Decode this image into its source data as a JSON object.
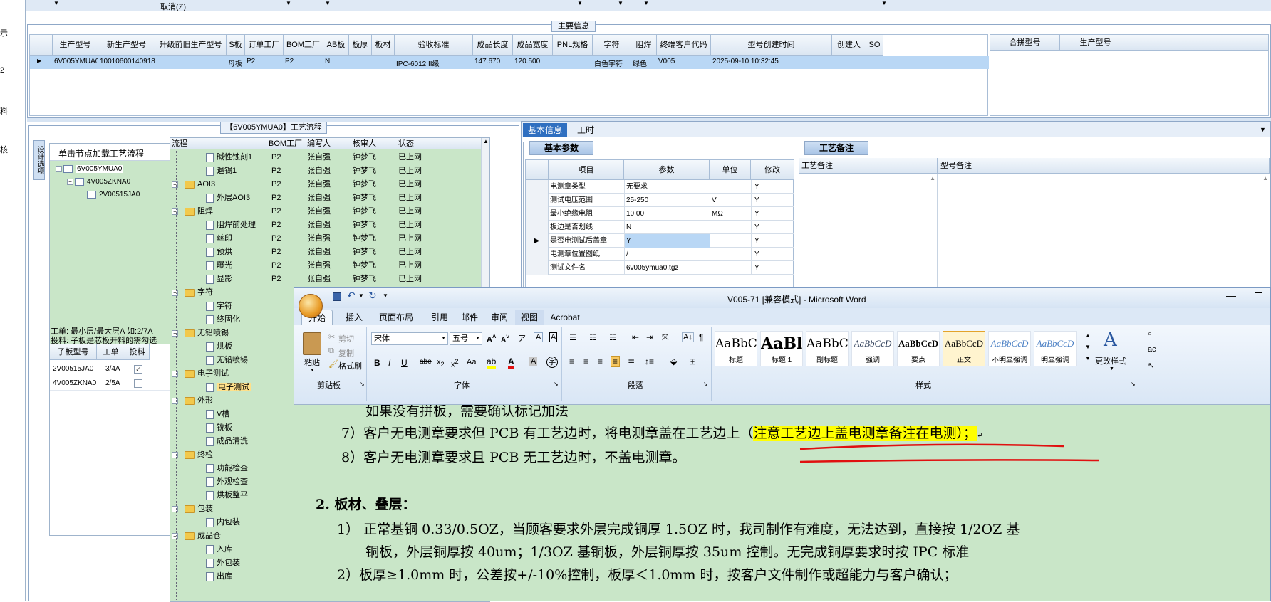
{
  "left_edge": {
    "items": [
      "示",
      "2",
      "料",
      "核"
    ]
  },
  "topbar": {
    "cancel_label": "取消(Z)"
  },
  "main_info": {
    "title": "主要信息",
    "columns": [
      "生产型号",
      "新生产型号",
      "升级前旧生产型号",
      "S板",
      "订单工厂",
      "BOM工厂",
      "AB板",
      "板厚",
      "板材",
      "验收标准",
      "成品长度",
      "成品宽度",
      "PNL规格",
      "字符",
      "阻焊",
      "终端客户代码",
      "型号创建时间",
      "创建人",
      "SO"
    ],
    "row": [
      "6V005YMUA0",
      "10010600140918",
      "",
      "母板",
      "P2",
      "P2",
      "N",
      "",
      "",
      "IPC-6012 II级",
      "147.670",
      "120.500",
      "",
      "白色字符",
      "绿色",
      "V005",
      "2025-09-10 10:32:45",
      "",
      ""
    ],
    "right_columns": [
      "合拼型号",
      "生产型号"
    ]
  },
  "process": {
    "title": "【6V005YMUA0】工艺流程",
    "side_tab": "设计选项",
    "tree_header": "单击节点加载工艺流程",
    "tree": [
      "6V005YMUA0",
      "4V005ZKNA0",
      "2V00515JA0"
    ],
    "note_line1": "工单: 最小层/最大层A 如:2/7A",
    "note_line2": "投料: 子板是芯板开料的需勾选",
    "sub_columns": [
      "子板型号",
      "工单",
      "投料"
    ],
    "sub_rows": [
      {
        "model": "2V00515JA0",
        "order": "3/4A",
        "checked": true
      },
      {
        "model": "4V005ZKNA0",
        "order": "2/5A",
        "checked": false
      }
    ],
    "flow_columns": [
      "流程",
      "BOM工厂",
      "编写人",
      "核审人",
      "状态"
    ],
    "flow_rows": [
      {
        "name": "碱性蚀刻1",
        "type": "doc",
        "indent": 2,
        "bom": "P2",
        "writer": "张自强",
        "reviewer": "钟梦飞",
        "status": "已上网"
      },
      {
        "name": "退锡1",
        "type": "doc",
        "indent": 2,
        "bom": "P2",
        "writer": "张自强",
        "reviewer": "钟梦飞",
        "status": "已上网"
      },
      {
        "name": "AOI3",
        "type": "folder",
        "indent": 1,
        "bom": "P2",
        "writer": "张自强",
        "reviewer": "钟梦飞",
        "status": "已上网"
      },
      {
        "name": "外层AOI3",
        "type": "doc",
        "indent": 2,
        "bom": "P2",
        "writer": "张自强",
        "reviewer": "钟梦飞",
        "status": "已上网"
      },
      {
        "name": "阻焊",
        "type": "folder",
        "indent": 1,
        "bom": "P2",
        "writer": "张自强",
        "reviewer": "钟梦飞",
        "status": "已上网"
      },
      {
        "name": "阻焊前处理",
        "type": "doc",
        "indent": 2,
        "bom": "P2",
        "writer": "张自强",
        "reviewer": "钟梦飞",
        "status": "已上网"
      },
      {
        "name": "丝印",
        "type": "doc",
        "indent": 2,
        "bom": "P2",
        "writer": "张自强",
        "reviewer": "钟梦飞",
        "status": "已上网"
      },
      {
        "name": "预烘",
        "type": "doc",
        "indent": 2,
        "bom": "P2",
        "writer": "张自强",
        "reviewer": "钟梦飞",
        "status": "已上网"
      },
      {
        "name": "曝光",
        "type": "doc",
        "indent": 2,
        "bom": "P2",
        "writer": "张自强",
        "reviewer": "钟梦飞",
        "status": "已上网"
      },
      {
        "name": "显影",
        "type": "doc",
        "indent": 2,
        "bom": "P2",
        "writer": "张自强",
        "reviewer": "钟梦飞",
        "status": "已上网"
      },
      {
        "name": "字符",
        "type": "folder",
        "indent": 1,
        "bom": "",
        "writer": "",
        "reviewer": "",
        "status": ""
      },
      {
        "name": "字符",
        "type": "doc",
        "indent": 2,
        "bom": "",
        "writer": "",
        "reviewer": "",
        "status": ""
      },
      {
        "name": "终固化",
        "type": "doc",
        "indent": 2,
        "bom": "",
        "writer": "",
        "reviewer": "",
        "status": ""
      },
      {
        "name": "无铅喷锡",
        "type": "folder",
        "indent": 1,
        "bom": "",
        "writer": "",
        "reviewer": "",
        "status": ""
      },
      {
        "name": "烘板",
        "type": "doc",
        "indent": 2,
        "bom": "",
        "writer": "",
        "reviewer": "",
        "status": ""
      },
      {
        "name": "无铅喷锡",
        "type": "doc",
        "indent": 2,
        "bom": "",
        "writer": "",
        "reviewer": "",
        "status": ""
      },
      {
        "name": "电子测试",
        "type": "folder",
        "indent": 1,
        "bom": "",
        "writer": "",
        "reviewer": "",
        "status": ""
      },
      {
        "name": "电子测试",
        "type": "doc",
        "indent": 2,
        "bom": "",
        "writer": "",
        "reviewer": "",
        "status": "",
        "selected": true
      },
      {
        "name": "外形",
        "type": "folder",
        "indent": 1,
        "bom": "",
        "writer": "",
        "reviewer": "",
        "status": ""
      },
      {
        "name": "V槽",
        "type": "doc",
        "indent": 2,
        "bom": "",
        "writer": "",
        "reviewer": "",
        "status": ""
      },
      {
        "name": "铣板",
        "type": "doc",
        "indent": 2,
        "bom": "",
        "writer": "",
        "reviewer": "",
        "status": ""
      },
      {
        "name": "成品清洗",
        "type": "doc",
        "indent": 2,
        "bom": "",
        "writer": "",
        "reviewer": "",
        "status": ""
      },
      {
        "name": "终检",
        "type": "folder",
        "indent": 1,
        "bom": "",
        "writer": "",
        "reviewer": "",
        "status": ""
      },
      {
        "name": "功能检查",
        "type": "doc",
        "indent": 2,
        "bom": "",
        "writer": "",
        "reviewer": "",
        "status": ""
      },
      {
        "name": "外观检查",
        "type": "doc",
        "indent": 2,
        "bom": "",
        "writer": "",
        "reviewer": "",
        "status": ""
      },
      {
        "name": "烘板整平",
        "type": "doc",
        "indent": 2,
        "bom": "",
        "writer": "",
        "reviewer": "",
        "status": ""
      },
      {
        "name": "包装",
        "type": "folder",
        "indent": 1,
        "bom": "",
        "writer": "",
        "reviewer": "",
        "status": ""
      },
      {
        "name": "内包装",
        "type": "doc",
        "indent": 2,
        "bom": "",
        "writer": "",
        "reviewer": "",
        "status": ""
      },
      {
        "name": "成品仓",
        "type": "folder",
        "indent": 1,
        "bom": "",
        "writer": "",
        "reviewer": "",
        "status": ""
      },
      {
        "name": "入库",
        "type": "doc",
        "indent": 2,
        "bom": "",
        "writer": "",
        "reviewer": "",
        "status": ""
      },
      {
        "name": "外包装",
        "type": "doc",
        "indent": 2,
        "bom": "",
        "writer": "",
        "reviewer": "",
        "status": ""
      },
      {
        "name": "出库",
        "type": "doc",
        "indent": 2,
        "bom": "",
        "writer": "",
        "reviewer": "",
        "status": ""
      }
    ]
  },
  "right_panel": {
    "tabs": [
      "基本信息",
      "工时"
    ],
    "params_tab": "基本参数",
    "params_columns": [
      "项目",
      "参数",
      "单位",
      "修改"
    ],
    "params_rows": [
      {
        "item": "电测章类型",
        "value": "无要求",
        "unit": "",
        "edit": "Y"
      },
      {
        "item": "测试电压范围",
        "value": "25-250",
        "unit": "V",
        "edit": "Y"
      },
      {
        "item": "最小绝缘电阻",
        "value": "10.00",
        "unit": "MΩ",
        "edit": "Y"
      },
      {
        "item": "板边是否划线",
        "value": "N",
        "unit": "",
        "edit": "Y"
      },
      {
        "item": "是否电测试后盖章",
        "value": "Y",
        "unit": "",
        "edit": "Y",
        "selected": true
      },
      {
        "item": "电测章位置图纸",
        "value": "/",
        "unit": "",
        "edit": "Y"
      },
      {
        "item": "测试文件名",
        "value": "6v005ymua0.tgz",
        "unit": "",
        "edit": "Y"
      }
    ],
    "remarks_tab": "工艺备注",
    "remarks_columns": [
      "工艺备注",
      "型号备注"
    ]
  },
  "word": {
    "title": "V005-71 [兼容模式] - Microsoft Word",
    "tabs": [
      "开始",
      "插入",
      "页面布局",
      "引用",
      "邮件",
      "审阅",
      "视图",
      "Acrobat"
    ],
    "clipboard": {
      "paste": "粘贴",
      "cut": "剪切",
      "copy": "复制",
      "format": "格式刷",
      "group": "剪贴板"
    },
    "font": {
      "name": "宋体",
      "size": "五号",
      "group": "字体"
    },
    "paragraph_group": "段落",
    "styles": [
      {
        "sample": "AaBbC",
        "label": "标题"
      },
      {
        "sample": "AaBl",
        "label": "标题 1"
      },
      {
        "sample": "AaBbC",
        "label": "副标题"
      },
      {
        "sample": "AaBbCcD",
        "label": "强调"
      },
      {
        "sample": "AaBbCcD",
        "label": "要点"
      },
      {
        "sample": "AaBbCcD",
        "label": "正文"
      },
      {
        "sample": "AaBbCcD",
        "label": "不明显强调"
      },
      {
        "sample": "AaBbCcD",
        "label": "明显强调"
      }
    ],
    "change_styles": "更改样式",
    "styles_group": "样式",
    "doc": {
      "line0": "如果没有拼板，需要确认标记加法",
      "line7_prefix": "7）客户无电测章要求但 PCB 有工艺边时，将电测章盖在工艺边上（",
      "line7_highlight": "注意工艺边上盖电测章备注在电测）；",
      "line8": "8）客户无电测章要求且 PCB 无工艺边时，不盖电测章。",
      "heading2": "2.  板材、叠层：",
      "item1_line1": "1） 正常基铜 0.33/0.5OZ，当顾客要求外层完成铜厚 1.5OZ 时，我司制作有难度，无法达到，直接按 1/2OZ 基",
      "item1_line2": "铜板，外层铜厚按 40um；1/3OZ 基铜板，外层铜厚按 35um 控制。无完成铜厚要求时按 IPC 标准",
      "item2_line1": "2）板厚≥1.0mm 时，公差按+/-10%控制，板厚＜1.0mm 时，按客户文件制作或超能力与客户确认；"
    },
    "colors": {
      "highlight": "#ffff00",
      "underline": "#e01010",
      "doc_bg": "#c9e6c8"
    }
  }
}
